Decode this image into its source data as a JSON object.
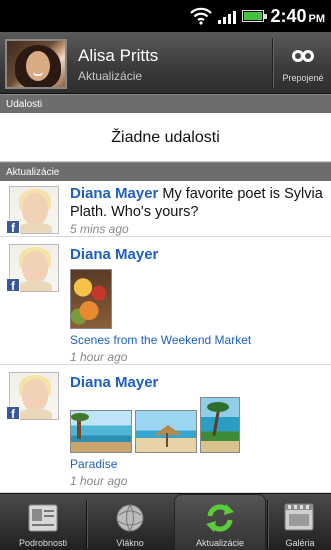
{
  "status_bar": {
    "time": "2:40",
    "ampm": "PM"
  },
  "header": {
    "name": "Alisa Pritts",
    "subtitle": "Aktualizácie",
    "link_button_label": "Prepojené"
  },
  "events_section": {
    "title": "Udalosti",
    "empty_text": "Žiadne udalosti"
  },
  "updates_section": {
    "title": "Aktualizácie",
    "items": [
      {
        "user": "Diana Mayer",
        "message": " My favorite poet is Sylvia Plath. Who's yours?",
        "time": "5 mins ago",
        "source": "f"
      },
      {
        "user": "Diana Mayer",
        "album": "Scenes from the Weekend Market",
        "time": "1 hour ago",
        "source": "f"
      },
      {
        "user": "Diana Mayer",
        "album": "Paradise",
        "time": "1 hour ago",
        "source": "f"
      }
    ]
  },
  "tabs": [
    {
      "label": "Podrobnosti",
      "icon": "details-icon",
      "selected": false
    },
    {
      "label": "Vlákno",
      "icon": "thread-icon",
      "selected": false
    },
    {
      "label": "Aktualizácie",
      "icon": "refresh-icon",
      "selected": true
    },
    {
      "label": "Galéria",
      "icon": "gallery-icon",
      "selected": false
    }
  ],
  "colors": {
    "accent_green": "#46c23b",
    "link_blue": "#1f5fbf",
    "facebook_blue": "#3b5998"
  }
}
